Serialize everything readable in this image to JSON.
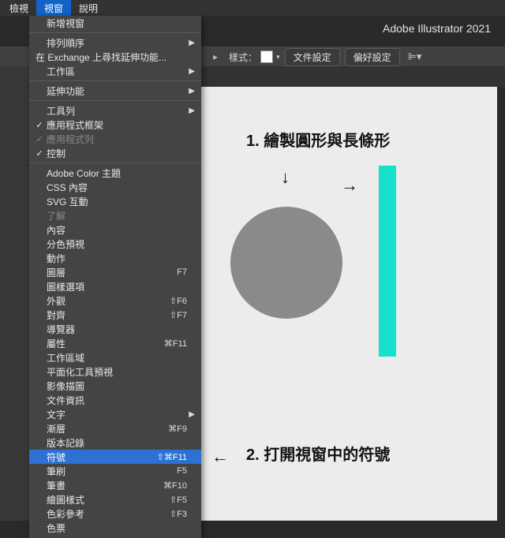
{
  "menubar": {
    "items": [
      "檢視",
      "視窗",
      "說明"
    ],
    "active_index": 1
  },
  "app_title": "Adobe Illustrator 2021",
  "toolbar": {
    "style_label": "樣式：",
    "doc_setup": "文件設定",
    "pref": "偏好設定",
    "chevron": "▸",
    "caret": "▾"
  },
  "dropdown": {
    "groups": [
      [
        {
          "label": "新增視窗"
        }
      ],
      [
        {
          "label": "排列順序",
          "sub": true
        },
        {
          "label": "在 Exchange 上尋找延伸功能..."
        },
        {
          "label": "工作區",
          "sub": true
        }
      ],
      [
        {
          "label": "延伸功能",
          "sub": true
        }
      ],
      [
        {
          "label": "工具列",
          "sub": true
        },
        {
          "label": "應用程式框架",
          "checked": true
        },
        {
          "label": "應用程式列",
          "checked": true,
          "dim": true
        },
        {
          "label": "控制",
          "checked": true
        }
      ],
      [
        {
          "label": "Adobe Color 主題"
        },
        {
          "label": "CSS 內容"
        },
        {
          "label": "SVG 互動"
        },
        {
          "label": "了解",
          "dim": true
        },
        {
          "label": "內容"
        },
        {
          "label": "分色預視"
        },
        {
          "label": "動作"
        },
        {
          "label": "圖層",
          "shortcut": "F7"
        },
        {
          "label": "圖樣選項"
        },
        {
          "label": "外觀",
          "shortcut": "⇧F6"
        },
        {
          "label": "對齊",
          "shortcut": "⇧F7"
        },
        {
          "label": "導覽器"
        },
        {
          "label": "屬性",
          "shortcut": "⌘F11"
        },
        {
          "label": "工作區域"
        },
        {
          "label": "平面化工具預視"
        },
        {
          "label": "影像描圖"
        },
        {
          "label": "文件資訊"
        },
        {
          "label": "文字",
          "sub": true
        },
        {
          "label": "漸層",
          "shortcut": "⌘F9"
        },
        {
          "label": "版本記錄"
        },
        {
          "label": "符號",
          "shortcut": "⇧⌘F11",
          "highlight": true
        },
        {
          "label": "筆刷",
          "shortcut": "F5"
        },
        {
          "label": "筆畫",
          "shortcut": "⌘F10"
        },
        {
          "label": "繪圖樣式",
          "shortcut": "⇧F5"
        },
        {
          "label": "色彩參考",
          "shortcut": "⇧F3"
        },
        {
          "label": "色票"
        }
      ]
    ]
  },
  "annotations": {
    "step1": "1. 繪製圓形與長條形",
    "step2": "2. 打開視窗中的符號",
    "down_arrow": "↓",
    "right_arrow": "→",
    "left_arrow": "←"
  },
  "colors": {
    "highlight": "#2d72d2",
    "accent_bar": "#14e0cc",
    "circle": "#8a8a8a"
  }
}
